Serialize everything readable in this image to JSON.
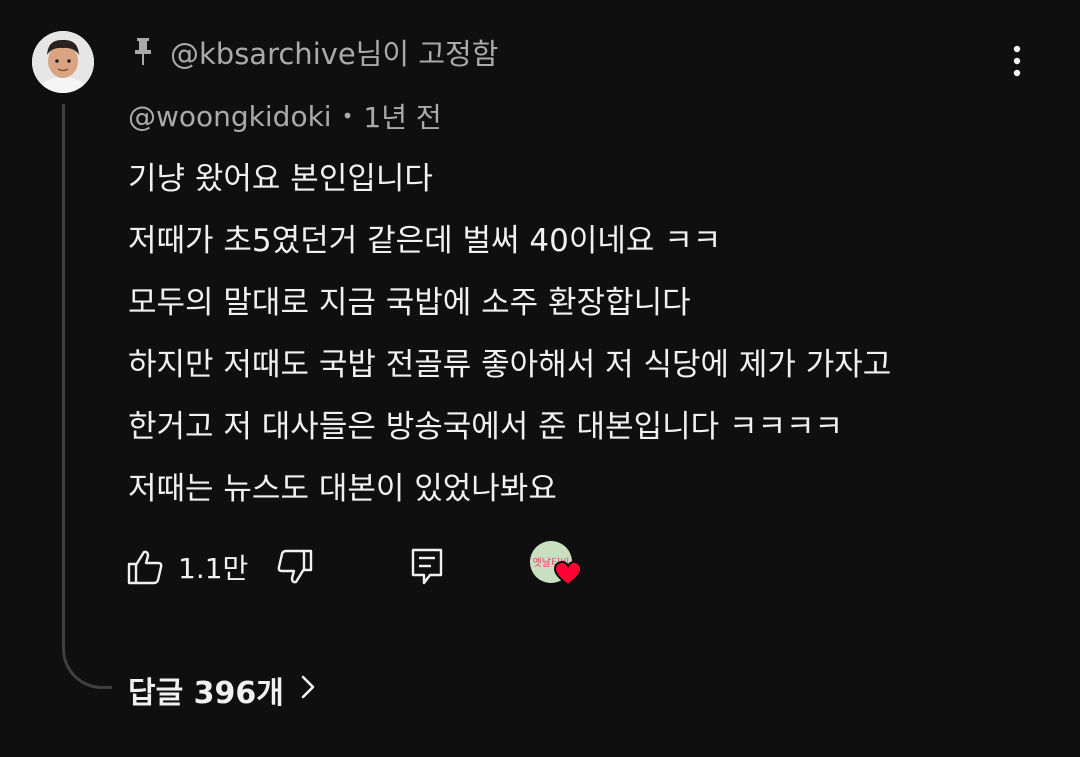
{
  "pinned": {
    "text": "@kbsarchive님이 고정함",
    "pin_icon": "pin-icon"
  },
  "comment": {
    "author": "@woongkidoki",
    "separator": "•",
    "time": "1년 전",
    "lines": [
      "기냥 왔어요 본인입니다",
      "저때가 초5였던거 같은데 벌써 40이네요 ㅋㅋ",
      "모두의 말대로 지금 국밥에 소주 환장합니다",
      "하지만 저때도 국밥 전골류 좋아해서 저 식당에 제가 가자고",
      "한거고 저 대사들은 방송국에서 준 대본입니다 ㅋㅋㅋㅋ",
      "저때는 뉴스도 대본이 있었나봐요"
    ],
    "like_count": "1.1만"
  },
  "creator_badge": {
    "avatar_text": "옛날티비",
    "heart_color": "#ff0033"
  },
  "replies": {
    "label": "답글 396개",
    "chevron": "›"
  },
  "colors": {
    "background": "#0f0f0f",
    "primary_text": "#f1f1f1",
    "secondary_text": "#aaaaaa",
    "heart": "#ff0033"
  }
}
